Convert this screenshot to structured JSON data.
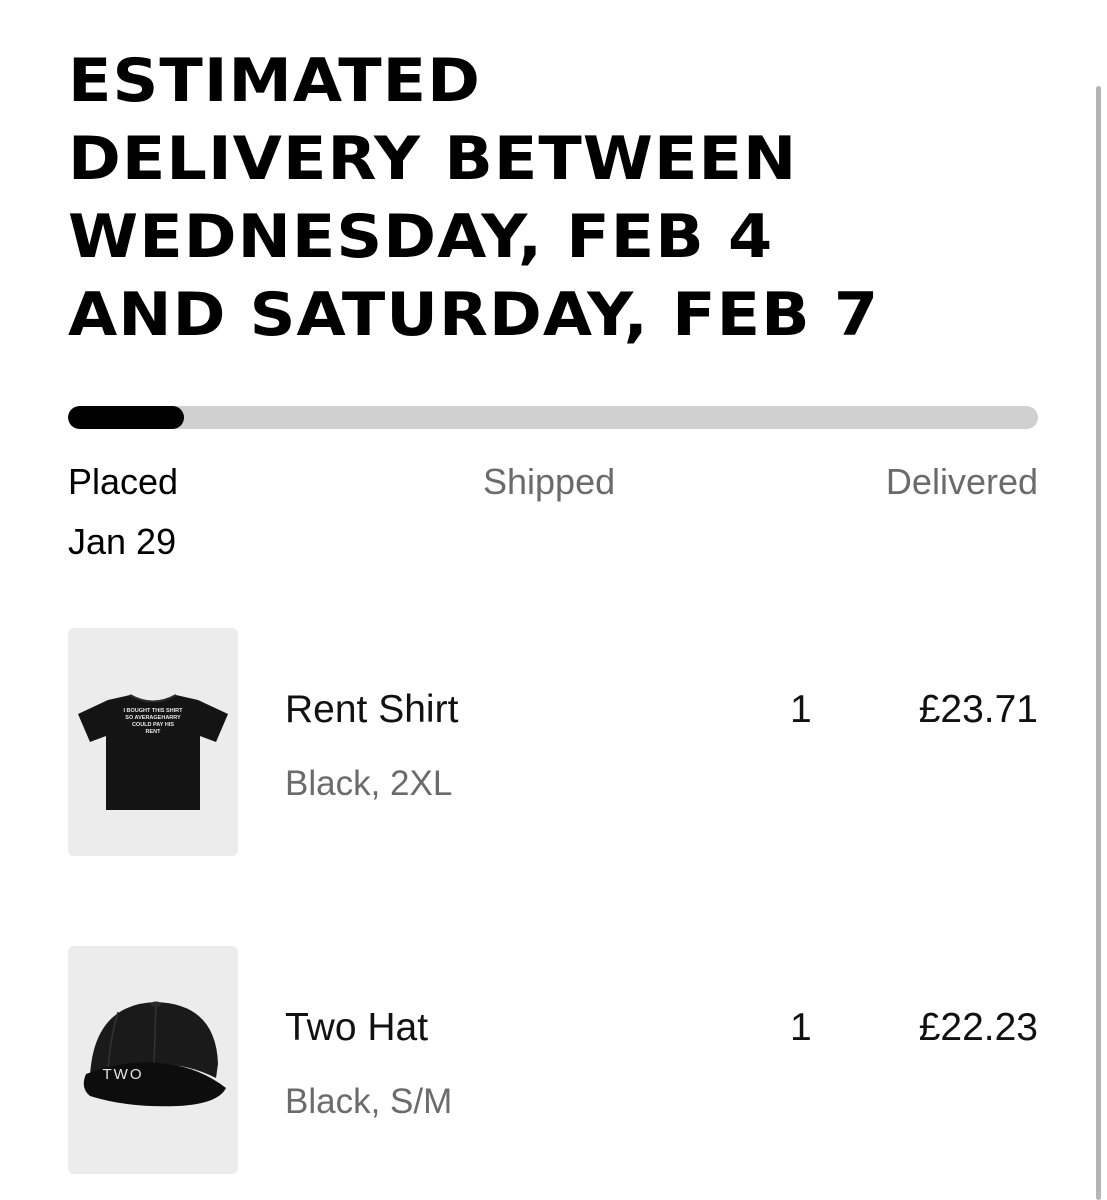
{
  "delivery": {
    "headline_lines": [
      "ESTIMATED",
      "DELIVERY BETWEEN",
      "WEDNESDAY, FEB 4",
      "AND SATURDAY, FEB 7"
    ]
  },
  "progress": {
    "fraction": 0.12,
    "steps": [
      {
        "label": "Placed",
        "date": "Jan 29",
        "active": true
      },
      {
        "label": "Shipped",
        "active": false
      },
      {
        "label": "Delivered",
        "active": false
      }
    ]
  },
  "items": [
    {
      "name": "Rent Shirt",
      "variant": "Black, 2XL",
      "quantity": "1",
      "price": "£23.71",
      "image_icon": "t-shirt-icon",
      "image_text_lines": [
        "I BOUGHT THIS SHIRT",
        "SO AVERAGEHARRY",
        "COULD PAY HIS",
        "RENT"
      ]
    },
    {
      "name": "Two Hat",
      "variant": "Black, S/M",
      "quantity": "1",
      "price": "£22.23",
      "image_icon": "cap-icon",
      "image_text": "TWO"
    }
  ],
  "colors": {
    "text": "#000000",
    "muted": "#6b6b6b",
    "track": "#d0d0d0",
    "fill": "#000000",
    "thumb_bg": "#ececec"
  }
}
